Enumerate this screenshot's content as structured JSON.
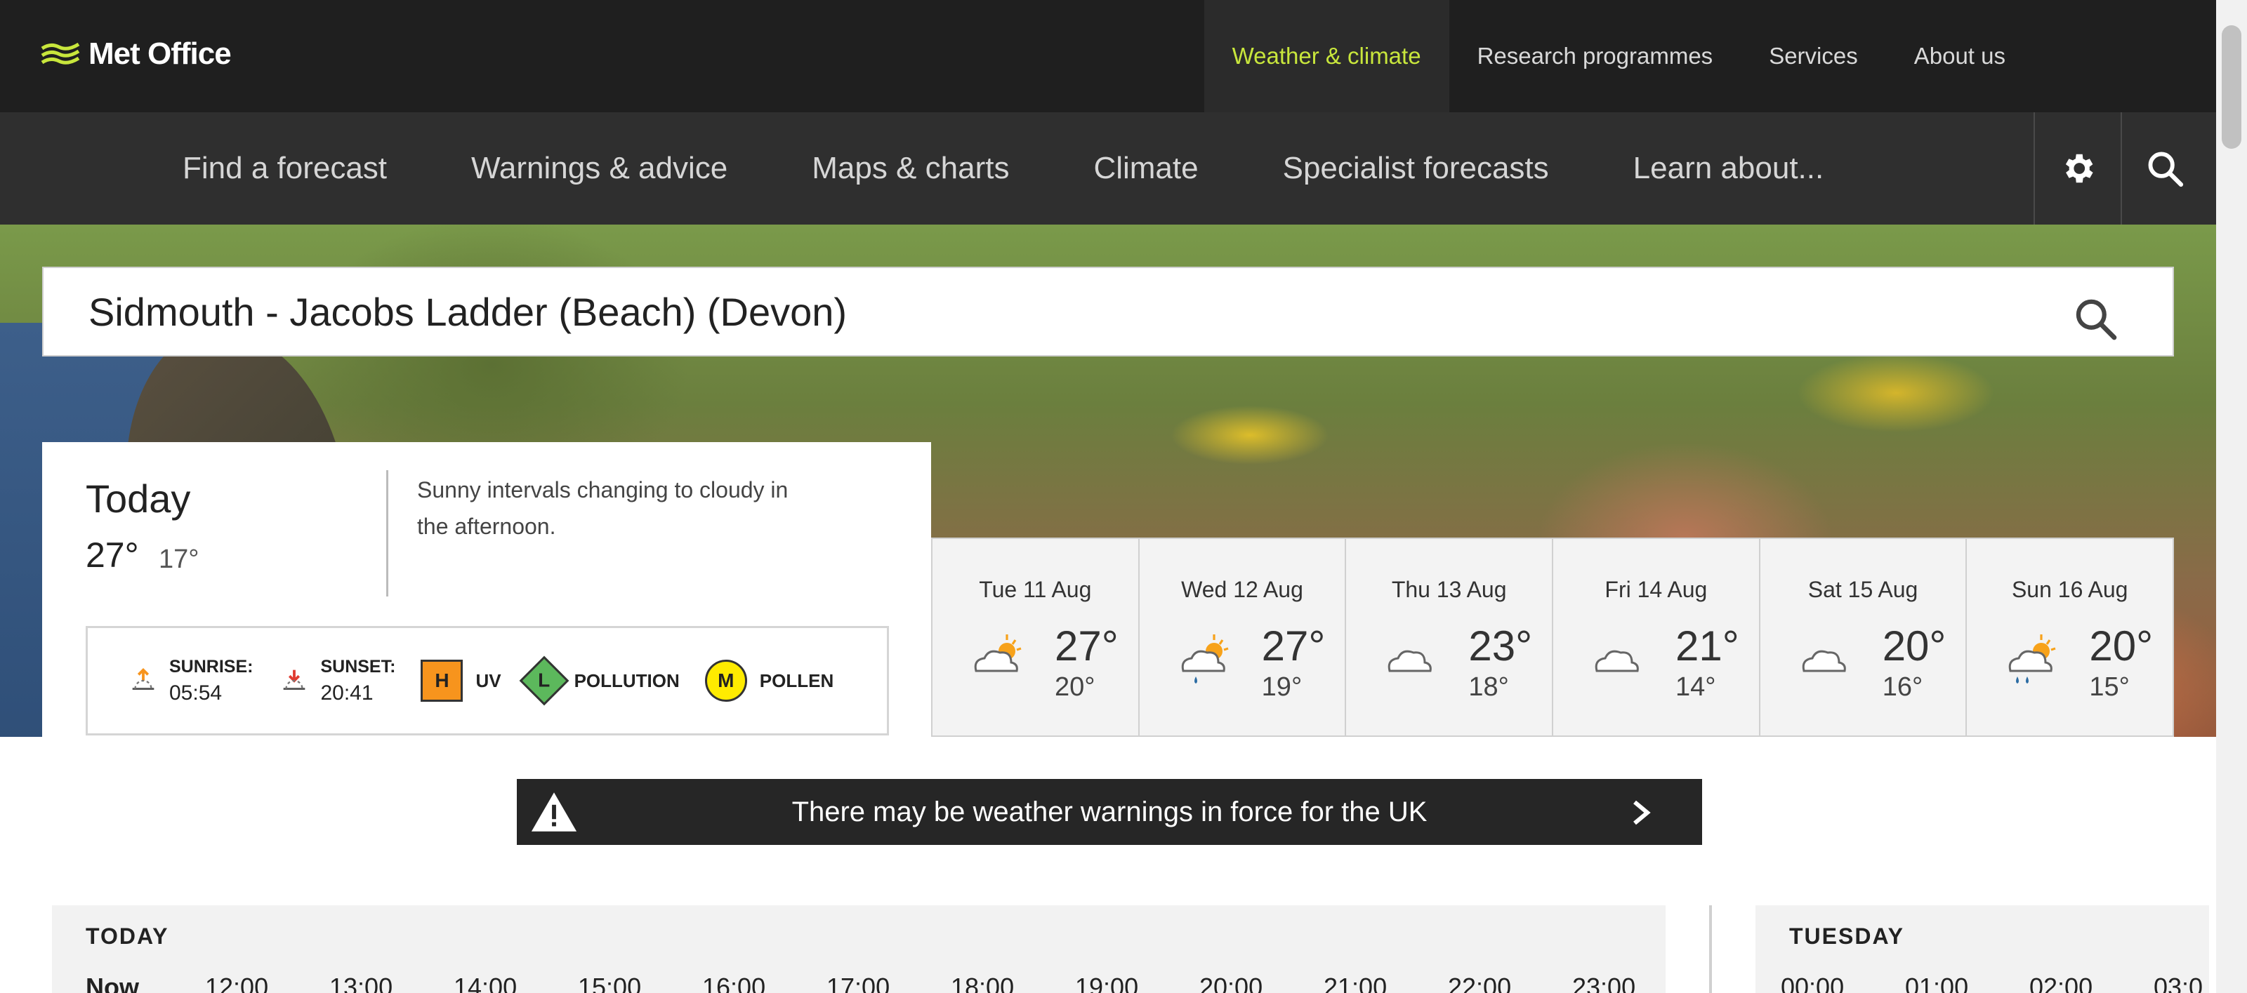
{
  "header": {
    "logo_text": "Met Office",
    "top_nav": [
      {
        "label": "Weather & climate",
        "active": true
      },
      {
        "label": "Research programmes",
        "active": false
      },
      {
        "label": "Services",
        "active": false
      },
      {
        "label": "About us",
        "active": false
      }
    ],
    "accent_color": "#c8e63c"
  },
  "sub_nav": {
    "items": [
      "Find a forecast",
      "Warnings & advice",
      "Maps & charts",
      "Climate",
      "Specialist forecasts",
      "Learn about..."
    ],
    "icons": [
      "gear-icon",
      "search-icon"
    ]
  },
  "location_search": {
    "value": "Sidmouth - Jacobs Ladder (Beach) (Devon)",
    "icon": "search-icon"
  },
  "today": {
    "title": "Today",
    "high": "27°",
    "low": "17°",
    "summary": "Sunny intervals changing to cloudy in the afternoon.",
    "sunrise_label": "SUNRISE:",
    "sunrise": "05:54",
    "sunset_label": "SUNSET:",
    "sunset": "20:41",
    "uv_level": "H",
    "uv_label": "UV",
    "uv_color": "#f7941d",
    "pollution_level": "L",
    "pollution_label": "POLLUTION",
    "pollution_color": "#5cb85c",
    "pollen_level": "M",
    "pollen_label": "POLLEN",
    "pollen_color": "#ffeb00"
  },
  "forecast_days": [
    {
      "label": "Tue 11 Aug",
      "high": "27°",
      "low": "20°",
      "icon": "cloud-icon"
    },
    {
      "label": "Wed 12 Aug",
      "high": "27°",
      "low": "19°",
      "icon": "sun-cloud-rain-icon"
    },
    {
      "label": "Thu 13 Aug",
      "high": "23°",
      "low": "18°",
      "icon": "cloud-icon"
    },
    {
      "label": "Fri 14 Aug",
      "high": "21°",
      "low": "14°",
      "icon": "cloud-icon"
    },
    {
      "label": "Sat 15 Aug",
      "high": "20°",
      "low": "16°",
      "icon": "cloud-icon"
    },
    {
      "label": "Sun 16 Aug",
      "high": "20°",
      "low": "15°",
      "icon": "sun-cloud-rain-icon"
    }
  ],
  "warning_banner": {
    "text": "There may be weather warnings in force for the UK"
  },
  "hourly_today": {
    "title": "TODAY",
    "hours": [
      "Now",
      "12:00",
      "13:00",
      "14:00",
      "15:00",
      "16:00",
      "17:00",
      "18:00",
      "19:00",
      "20:00",
      "21:00",
      "22:00",
      "23:00"
    ]
  },
  "hourly_tuesday": {
    "title": "TUESDAY",
    "hours": [
      "00:00",
      "01:00",
      "02:00",
      "03:0"
    ]
  }
}
